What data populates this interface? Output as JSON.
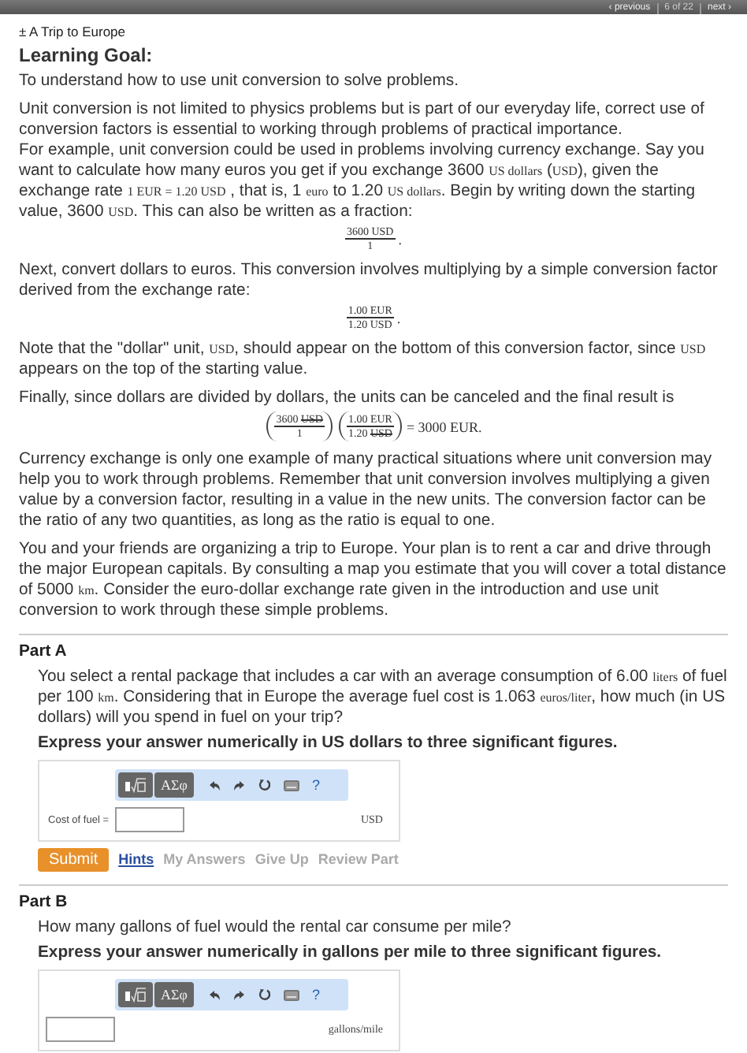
{
  "top_nav": [
    {
      "label": "‹ previous",
      "kind": "link"
    },
    {
      "label": "6 of 22",
      "kind": "counter"
    },
    {
      "label": "next ›",
      "kind": "link"
    }
  ],
  "title": "± A Trip to Europe",
  "learning_goal": {
    "heading": "Learning Goal:",
    "text": "To understand how to use unit conversion to solve problems."
  },
  "intro": [
    {
      "kind": "paragraph",
      "segments": [
        {
          "kind": "text",
          "text": "Unit conversion is not limited to physics problems but is part of our everyday life, correct use of conversion factors is essential to working through problems of practical importance."
        },
        {
          "kind": "break"
        },
        {
          "kind": "text",
          "text": "For example, unit conversion could be used in problems involving currency exchange. Say you want to calculate how many euros you get if you exchange 3600 "
        },
        {
          "kind": "unit",
          "text": "US dollars"
        },
        {
          "kind": "text",
          "text": " ("
        },
        {
          "kind": "unit",
          "text": "USD"
        },
        {
          "kind": "text",
          "text": "), given the exchange rate "
        },
        {
          "kind": "unit",
          "text": "1 EUR = 1.20 USD"
        },
        {
          "kind": "text",
          "text": " , that is, 1 "
        },
        {
          "kind": "unit",
          "text": "euro"
        },
        {
          "kind": "text",
          "text": " to 1.20 "
        },
        {
          "kind": "unit",
          "text": "US dollars"
        },
        {
          "kind": "text",
          "text": ". Begin by writing down the starting value, 3600 "
        },
        {
          "kind": "unit",
          "text": "USD"
        },
        {
          "kind": "text",
          "text": ". This can also be written as a fraction:"
        }
      ]
    },
    {
      "kind": "math",
      "terms": [
        {
          "kind": "fraction",
          "parens": false,
          "num": [
            {
              "text": "3600 USD",
              "struck": false
            }
          ],
          "den": [
            {
              "text": "1",
              "struck": false
            }
          ]
        },
        {
          "kind": "text",
          "text": "."
        }
      ]
    },
    {
      "kind": "paragraph",
      "segments": [
        {
          "kind": "text",
          "text": "Next, convert dollars to euros. This conversion involves multiplying by a simple conversion factor derived from the exchange rate:"
        }
      ]
    },
    {
      "kind": "math",
      "terms": [
        {
          "kind": "fraction",
          "parens": false,
          "num": [
            {
              "text": "1.00 EUR",
              "struck": false
            }
          ],
          "den": [
            {
              "text": "1.20 USD",
              "struck": false
            }
          ]
        },
        {
          "kind": "text",
          "text": "."
        }
      ]
    },
    {
      "kind": "paragraph",
      "segments": [
        {
          "kind": "text",
          "text": "Note that the \"dollar\" unit, "
        },
        {
          "kind": "unit",
          "text": "USD"
        },
        {
          "kind": "text",
          "text": ", should appear on the bottom of this conversion factor, since "
        },
        {
          "kind": "unit",
          "text": "USD"
        },
        {
          "kind": "text",
          "text": " appears on the top of the starting value."
        }
      ]
    },
    {
      "kind": "paragraph",
      "segments": [
        {
          "kind": "text",
          "text": "Finally, since dollars are divided by dollars, the units can be canceled and the final result is"
        }
      ]
    },
    {
      "kind": "math",
      "terms": [
        {
          "kind": "fraction",
          "parens": true,
          "num": [
            {
              "text": "3600 ",
              "struck": false
            },
            {
              "text": "USD",
              "struck": true
            }
          ],
          "den": [
            {
              "text": "1",
              "struck": false
            }
          ]
        },
        {
          "kind": "fraction",
          "parens": true,
          "num": [
            {
              "text": "1.00 EUR",
              "struck": false
            }
          ],
          "den": [
            {
              "text": "1.20 ",
              "struck": false
            },
            {
              "text": "USD",
              "struck": true
            }
          ]
        },
        {
          "kind": "text",
          "text": "= 3000 EUR."
        }
      ]
    },
    {
      "kind": "paragraph",
      "segments": [
        {
          "kind": "text",
          "text": "Currency exchange is only one example of many practical situations where unit conversion may help you to work through problems. Remember that unit conversion involves multiplying a given value by a conversion factor, resulting in a value in the new units. The conversion factor can be the ratio of any two quantities, as long as the ratio is equal to one."
        }
      ]
    },
    {
      "kind": "paragraph",
      "segments": [
        {
          "kind": "text",
          "text": "You and your friends are organizing a trip to Europe. Your plan is to rent a car and drive through the major European capitals. By consulting a map you estimate that you will cover a total distance of 5000 "
        },
        {
          "kind": "unit",
          "text": "km"
        },
        {
          "kind": "text",
          "text": ". Consider the euro-dollar exchange rate given in the introduction and use unit conversion to work through these simple problems."
        }
      ]
    }
  ],
  "parts": [
    {
      "title": "Part A",
      "question": [
        {
          "kind": "text",
          "text": "You select a rental package that includes a car with an average consumption of 6.00 "
        },
        {
          "kind": "unit",
          "text": "liters"
        },
        {
          "kind": "text",
          "text": " of fuel per 100 "
        },
        {
          "kind": "unit",
          "text": "km"
        },
        {
          "kind": "text",
          "text": ". Considering that in Europe the average fuel cost is 1.063 "
        },
        {
          "kind": "unit",
          "text": "euros/liter"
        },
        {
          "kind": "text",
          "text": ", how much (in US dollars) will you spend in fuel on your trip?"
        }
      ],
      "instruction": "Express your answer numerically in US dollars to three significant figures.",
      "toolbar": {
        "symbols_label": "ΑΣφ",
        "help_label": "?"
      },
      "answer": {
        "label": "Cost of fuel =",
        "unit": "USD"
      },
      "actions": [
        {
          "label": "Submit",
          "kind": "submit"
        },
        {
          "label": "Hints",
          "kind": "link"
        },
        {
          "label": "My Answers",
          "kind": "muted"
        },
        {
          "label": "Give Up",
          "kind": "muted"
        },
        {
          "label": "Review Part",
          "kind": "muted"
        }
      ]
    },
    {
      "title": "Part B",
      "question": [
        {
          "kind": "text",
          "text": "How many gallons of fuel would the rental car consume per mile?"
        }
      ],
      "instruction": "Express your answer numerically in gallons per mile to three significant figures.",
      "toolbar": {
        "symbols_label": "ΑΣφ",
        "help_label": "?"
      },
      "answer": {
        "unit": "gallons/mile"
      }
    }
  ]
}
